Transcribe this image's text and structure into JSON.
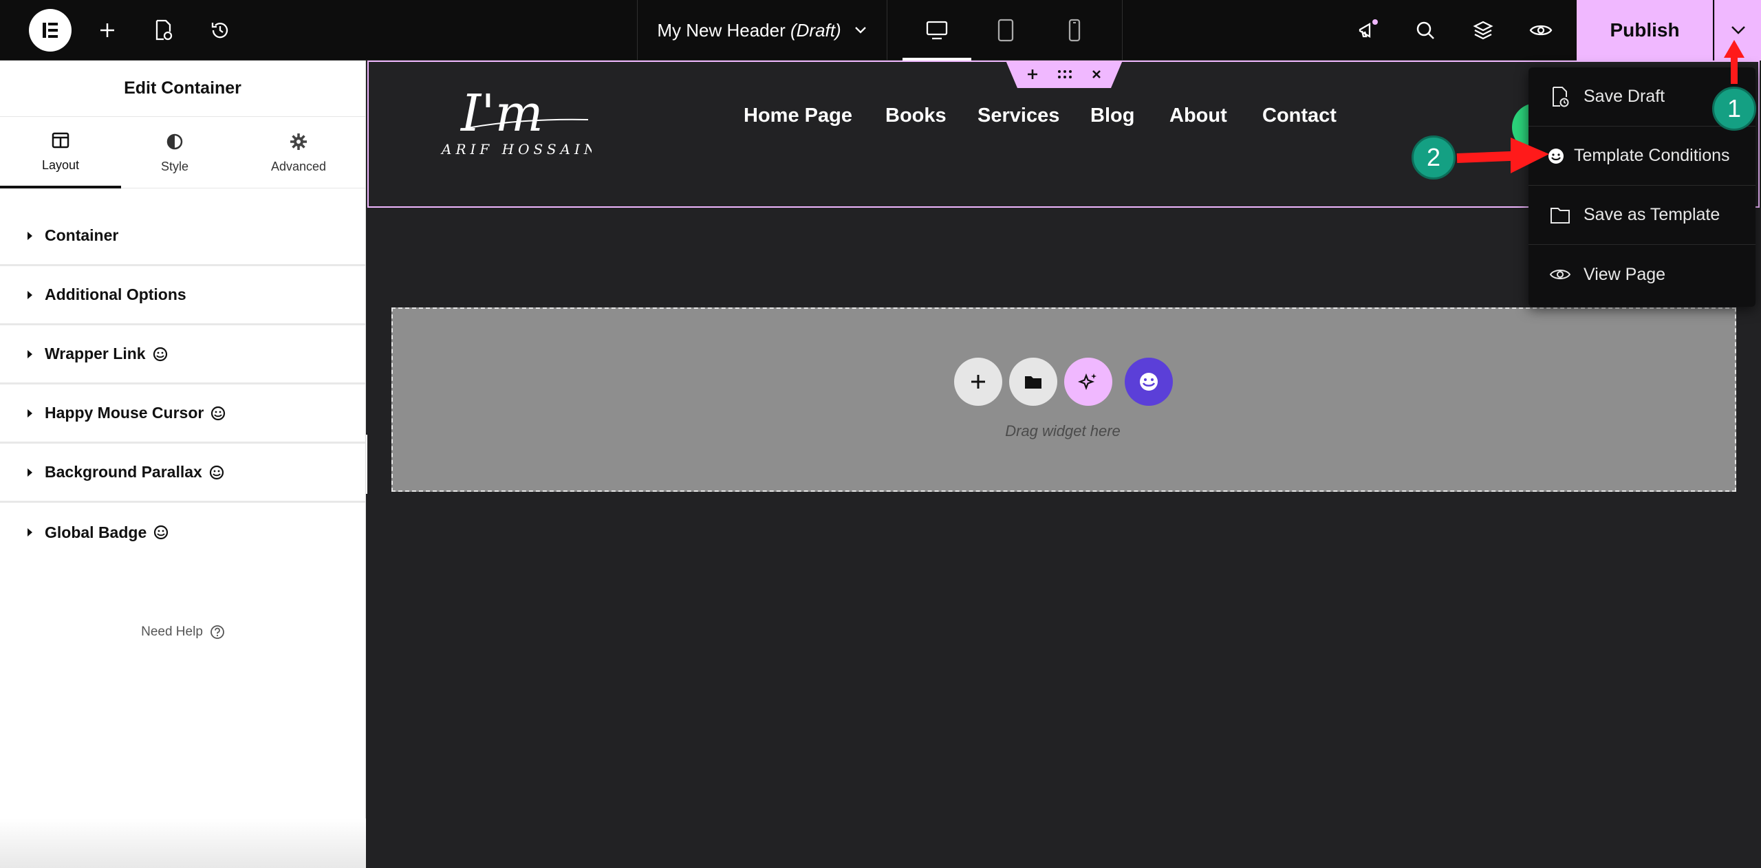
{
  "topbar": {
    "doc_title": "My New Header",
    "doc_status": "(Draft)",
    "publish_label": "Publish"
  },
  "panel": {
    "title": "Edit Container",
    "tabs": [
      {
        "label": "Layout",
        "icon": "layout-icon"
      },
      {
        "label": "Style",
        "icon": "half-circle-icon"
      },
      {
        "label": "Advanced",
        "icon": "gear-icon"
      }
    ],
    "sections": [
      {
        "label": "Container",
        "happy_addon": false
      },
      {
        "label": "Additional Options",
        "happy_addon": false
      },
      {
        "label": "Wrapper Link",
        "happy_addon": true
      },
      {
        "label": "Happy Mouse Cursor",
        "happy_addon": true
      },
      {
        "label": "Background Parallax",
        "happy_addon": true
      },
      {
        "label": "Global Badge",
        "happy_addon": true
      }
    ],
    "help_label": "Need Help"
  },
  "site_header": {
    "logo_main": "I'm",
    "logo_sub": "ARIF HOSSAIN",
    "nav": [
      "Home Page",
      "Books",
      "Services",
      "Blog",
      "About",
      "Contact"
    ]
  },
  "drop_zone": {
    "hint": "Drag widget here"
  },
  "publish_menu": {
    "items": [
      {
        "label": "Save Draft",
        "icon": "file-clock-icon"
      },
      {
        "label": "Template Conditions",
        "icon": "happy-addons-icon"
      },
      {
        "label": "Save as Template",
        "icon": "folder-icon"
      },
      {
        "label": "View Page",
        "icon": "eye-icon"
      }
    ]
  },
  "annotations": {
    "step1": "1",
    "step2": "2"
  },
  "colors": {
    "accent_pink": "#f0b8ff",
    "topbar_bg": "#0d0d0d",
    "canvas_bg": "#222224",
    "annotation_green": "#14a083",
    "arrow_red": "#ff1a1a"
  }
}
